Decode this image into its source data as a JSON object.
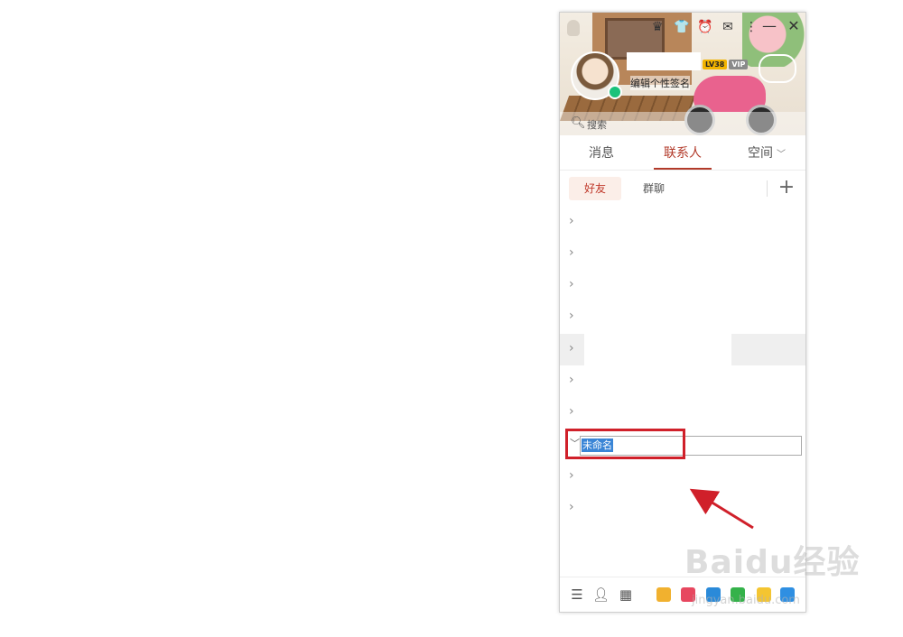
{
  "profile": {
    "signature": "编辑个性签名",
    "badges": [
      "LV38",
      "VIP"
    ]
  },
  "search": {
    "placeholder": "搜索"
  },
  "tabs": [
    {
      "label": "消息"
    },
    {
      "label": "联系人"
    },
    {
      "label": "空间"
    }
  ],
  "subtabs": [
    {
      "label": "好友"
    },
    {
      "label": "群聊"
    }
  ],
  "add_icon": "+",
  "edit_group": {
    "value": "未命名"
  },
  "window_controls": {
    "minimize": "—",
    "close": "✕"
  },
  "watermark": {
    "logo": "Baidu经验",
    "url": "jingyan.baidu.com"
  },
  "colors": {
    "accent": "#b23a2a",
    "selection": "#3a85d6",
    "annotation": "#d0202a",
    "online": "#19c27a"
  }
}
